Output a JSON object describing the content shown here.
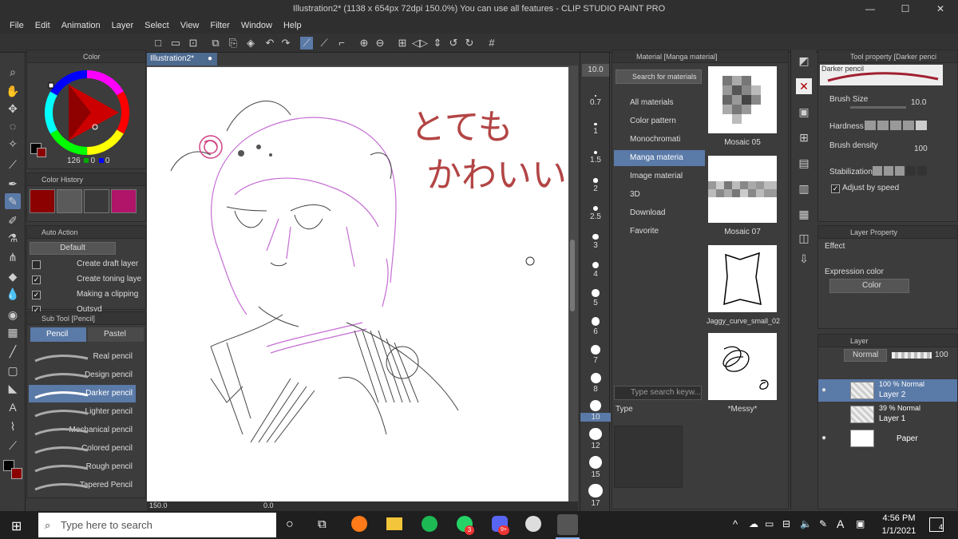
{
  "window": {
    "title": "Illustration2* (1138 x 654px 72dpi 150.0%)  You can use all features - CLIP STUDIO PAINT PRO",
    "controls": [
      "—",
      "☐",
      "✕"
    ]
  },
  "menu": [
    "File",
    "Edit",
    "Animation",
    "Layer",
    "Select",
    "View",
    "Filter",
    "Window",
    "Help"
  ],
  "canvas_tab": {
    "label": "Illustration2*"
  },
  "color_panel": {
    "tab": "Color",
    "values": {
      "r": "126",
      "g": "0",
      "b": "0"
    }
  },
  "color_history": {
    "title": "Color History",
    "swatches": [
      "#8b0000",
      "#5a5a5a",
      "#3a3a3a",
      "#b0156a"
    ]
  },
  "auto_action": {
    "title": "Auto Action",
    "set": "Default",
    "items": [
      {
        "label": "Create draft layer",
        "checked": false
      },
      {
        "label": "Create toning laye",
        "checked": true
      },
      {
        "label": "Making a clipping",
        "checked": true
      },
      {
        "label": "Outsyd",
        "checked": true
      }
    ]
  },
  "sub_tool": {
    "title": "Sub Tool [Pencil]",
    "tabs": [
      "Pencil",
      "Pastel"
    ],
    "brushes": [
      "Real pencil",
      "Design pencil",
      "Darker pencil",
      "Lighter pencil",
      "Mechanical pencil",
      "Colored pencil",
      "Rough pencil",
      "Tapered Pencil"
    ],
    "selected": "Darker pencil"
  },
  "brush_sizes": {
    "current": "10.0",
    "labels": [
      "0.7",
      "1",
      "1.5",
      "2",
      "2.5",
      "3",
      "4",
      "5",
      "6",
      "7",
      "8",
      "10",
      "12",
      "15",
      "17"
    ]
  },
  "status_bar": {
    "zoom": "150.0",
    "angle": "0.0"
  },
  "canvas_text": {
    "line1": "とても",
    "line2": "かわいい"
  },
  "material": {
    "title": "Material [Manga material]",
    "search": "Search for materials on A",
    "tree": [
      "All materials",
      "Color pattern",
      "Monochromati",
      "Manga materia",
      "Image material",
      "3D",
      "Download",
      "Favorite"
    ],
    "selected": "Manga materia",
    "items": [
      "Mosaic 05",
      "Mosaic 07",
      "Jaggy_curve_small_02",
      "*Messy*"
    ],
    "search_keyword_placeholder": "Type search keyw...",
    "type_label": "Type"
  },
  "tool_property": {
    "title": "Tool property [Darker penci",
    "brush_name": "Darker pencil",
    "brush_size_label": "Brush Size",
    "brush_size_value": "10.0",
    "hardness_label": "Hardness",
    "density_label": "Brush density",
    "density_value": "100",
    "stabilization_label": "Stabilization",
    "adjust_label": "Adjust by speed"
  },
  "layer_property": {
    "title": "Layer Property",
    "effect_label": "Effect",
    "expression_label": "Expression color",
    "expression_value": "Color"
  },
  "layers": {
    "title": "Layer",
    "blend": "Normal",
    "opacity": "100",
    "items": [
      {
        "mode": "100 % Normal",
        "name": "Layer 2"
      },
      {
        "mode": "39 % Normal",
        "name": "Layer 1"
      },
      {
        "mode": "",
        "name": "Paper"
      }
    ]
  },
  "taskbar": {
    "search_placeholder": "Type here to search",
    "time": "4:56 PM",
    "date": "1/1/2021",
    "notif_count": "4",
    "badges": {
      "whatsapp": "3",
      "discord": "9+"
    }
  }
}
